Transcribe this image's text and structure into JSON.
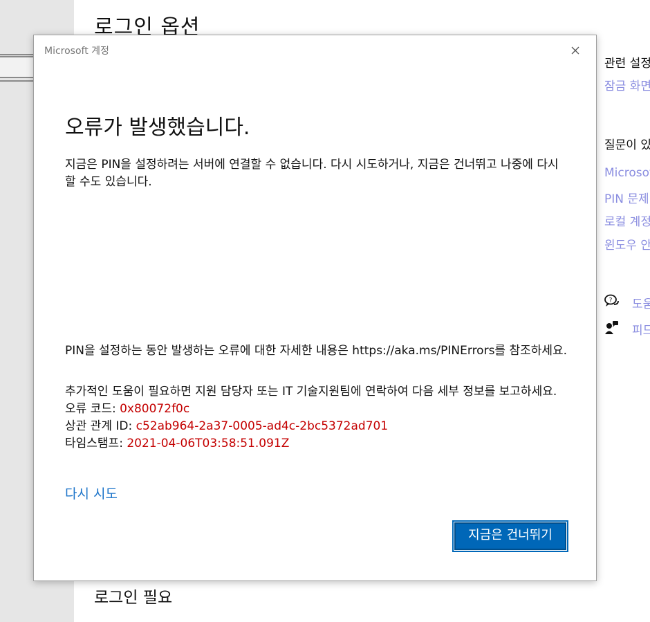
{
  "background": {
    "page_title": "로그인 옵션",
    "bottom_heading": "로그인 필요"
  },
  "right_panel": {
    "related_heading": "관련 설정",
    "related_link": "잠금 화면",
    "question_heading": "질문이 있",
    "links": [
      "Microsoft",
      "PIN 문제",
      "로컬 계정",
      "윈도우 안"
    ],
    "help_label": "도움",
    "feedback_label": "피드"
  },
  "dialog": {
    "caption": "Microsoft 계정",
    "heading": "오류가 발생했습니다.",
    "message": "지금은 PIN을 설정하려는 서버에 연결할 수 없습니다. 다시 시도하거나, 지금은 건너뛰고 나중에 다시 할 수도 있습니다.",
    "info": "PIN을 설정하는 동안 발생하는 오류에 대한 자세한 내용은 https://aka.ms/PINErrors를 참조하세요.",
    "support": "추가적인 도움이 필요하면 지원 담당자 또는 IT 기술지원팀에 연락하여 다음 세부 정보를 보고하세요.",
    "error_code_label": "오류 코드: ",
    "error_code": "0x80072f0c",
    "correlation_label": "상관 관계 ID: ",
    "correlation_id": "c52ab964-2a37-0005-ad4c-2bc5372ad701",
    "timestamp_label": "타임스탬프: ",
    "timestamp": "2021-04-06T03:58:51.091Z",
    "retry_label": "다시 시도",
    "skip_label": "지금은 건너뛰기"
  },
  "colors": {
    "accent": "#0067b8",
    "link": "#1a73c9",
    "error": "#c40000",
    "side_link": "#8a8de0"
  }
}
